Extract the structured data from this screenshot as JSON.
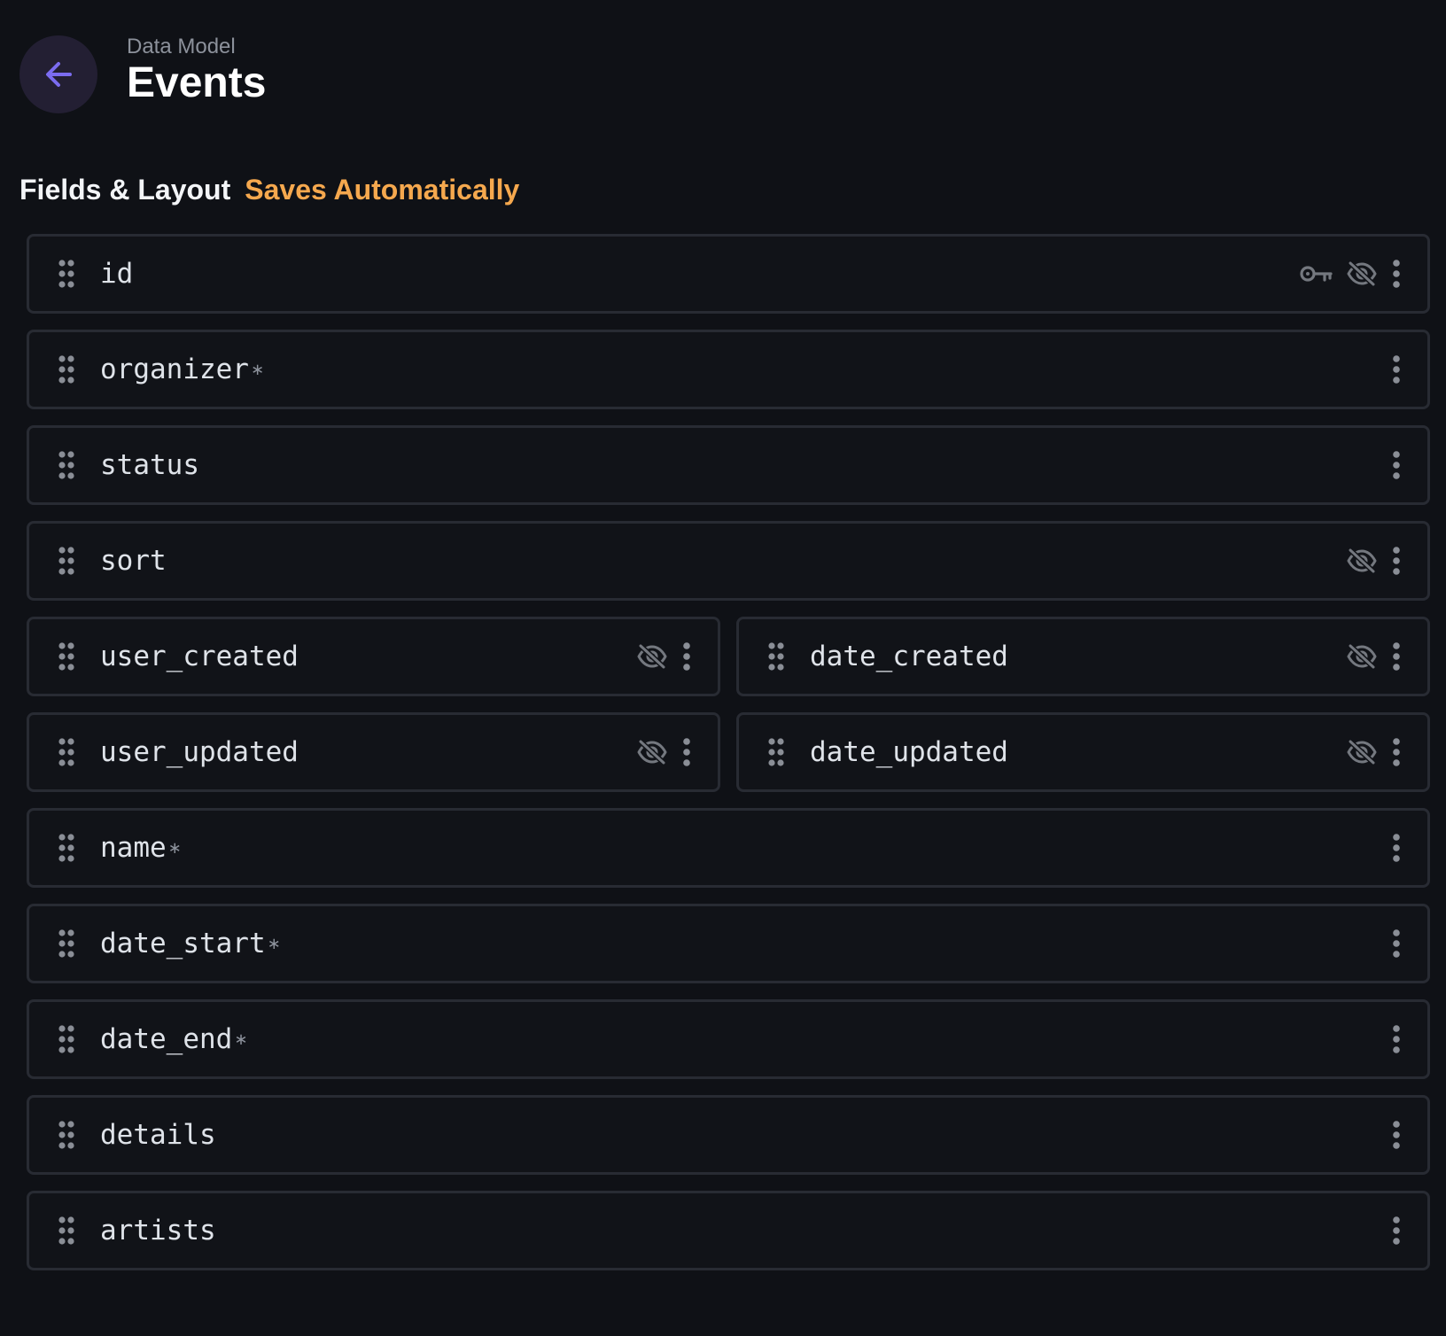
{
  "header": {
    "breadcrumb": "Data Model",
    "title": "Events",
    "back_icon": "arrow-left-icon",
    "accent": "#7b6cf0"
  },
  "section": {
    "label": "Fields & Layout",
    "status": "Saves Automatically",
    "status_color": "#f5a84e"
  },
  "rows": [
    [
      {
        "name": "id",
        "required": false,
        "primary_key": true,
        "hidden": true
      }
    ],
    [
      {
        "name": "organizer",
        "required": true,
        "primary_key": false,
        "hidden": false
      }
    ],
    [
      {
        "name": "status",
        "required": false,
        "primary_key": false,
        "hidden": false
      }
    ],
    [
      {
        "name": "sort",
        "required": false,
        "primary_key": false,
        "hidden": true
      }
    ],
    [
      {
        "name": "user_created",
        "required": false,
        "primary_key": false,
        "hidden": true
      },
      {
        "name": "date_created",
        "required": false,
        "primary_key": false,
        "hidden": true
      }
    ],
    [
      {
        "name": "user_updated",
        "required": false,
        "primary_key": false,
        "hidden": true
      },
      {
        "name": "date_updated",
        "required": false,
        "primary_key": false,
        "hidden": true
      }
    ],
    [
      {
        "name": "name",
        "required": true,
        "primary_key": false,
        "hidden": false
      }
    ],
    [
      {
        "name": "date_start",
        "required": true,
        "primary_key": false,
        "hidden": false
      }
    ],
    [
      {
        "name": "date_end",
        "required": true,
        "primary_key": false,
        "hidden": false
      }
    ],
    [
      {
        "name": "details",
        "required": false,
        "primary_key": false,
        "hidden": false
      }
    ],
    [
      {
        "name": "artists",
        "required": false,
        "primary_key": false,
        "hidden": false
      }
    ]
  ],
  "icons": {
    "drag": "drag-handle-icon",
    "key": "key-icon",
    "hidden": "eye-off-icon",
    "more": "more-vertical-icon",
    "required": "asterisk-icon"
  }
}
